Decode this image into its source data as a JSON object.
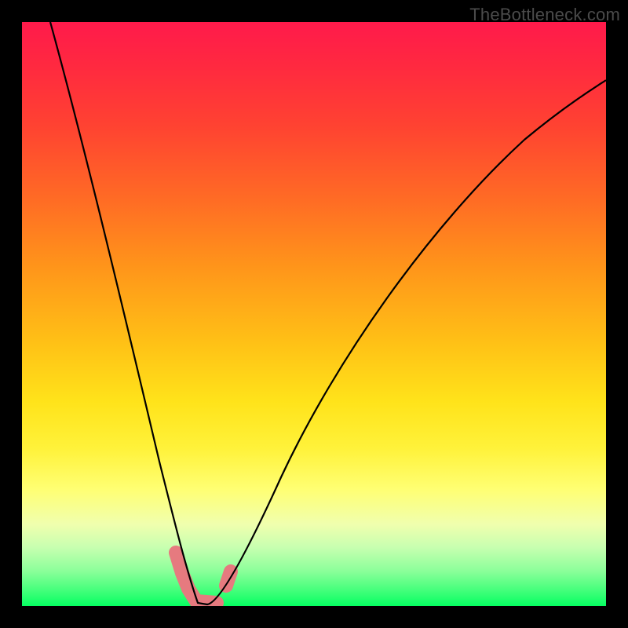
{
  "attribution": "TheBottleneck.com",
  "chart_data": {
    "type": "line",
    "title": "",
    "xlabel": "",
    "ylabel": "",
    "xlim": [
      0,
      100
    ],
    "ylim": [
      0,
      100
    ],
    "series": [
      {
        "name": "bottleneck-curve",
        "x": [
          5,
          10,
          15,
          20,
          24,
          27,
          29,
          30,
          31,
          32,
          34,
          38,
          45,
          55,
          65,
          75,
          85,
          95,
          100
        ],
        "values": [
          100,
          80,
          60,
          40,
          20,
          8,
          2,
          0,
          0,
          0,
          2,
          8,
          22,
          40,
          55,
          67,
          77,
          85,
          88
        ]
      }
    ],
    "markers": [
      {
        "name": "marker-a",
        "x": 27,
        "y": 8
      },
      {
        "name": "marker-b",
        "x": 28,
        "y": 4
      },
      {
        "name": "marker-c",
        "x": 29,
        "y": 1
      },
      {
        "name": "marker-d",
        "x": 30,
        "y": 0
      },
      {
        "name": "marker-e",
        "x": 32,
        "y": 0
      },
      {
        "name": "marker-f",
        "x": 35,
        "y": 3
      },
      {
        "name": "marker-g",
        "x": 36,
        "y": 6
      }
    ],
    "background_gradient": {
      "top": "#ff1a4b",
      "mid": "#ffe31a",
      "bottom": "#06ff62"
    }
  }
}
